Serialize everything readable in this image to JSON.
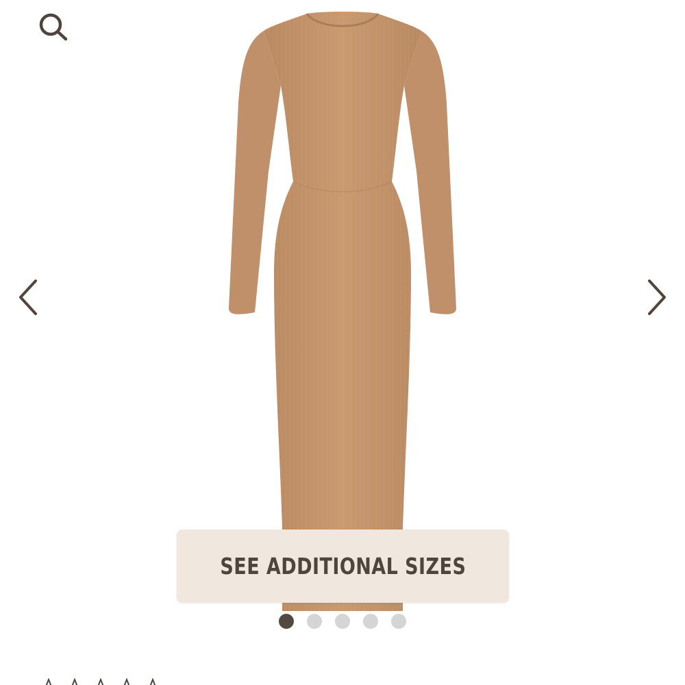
{
  "header": {
    "search_icon": "search-icon"
  },
  "carousel": {
    "prev_icon": "chevron-left-icon",
    "next_icon": "chevron-right-icon",
    "slide_count": 5,
    "active_slide": 1
  },
  "sizes_button": {
    "label": "SEE ADDITIONAL SIZES"
  },
  "rating": {
    "stars": 5,
    "star_icon": "star-outline-icon"
  },
  "colors": {
    "dress": "#c4956c",
    "button_bg": "#f0e8de",
    "button_text": "#4f453c",
    "icon": "#4f453c",
    "dot_active": "#524a42",
    "dot_inactive": "#d5d5d5"
  }
}
